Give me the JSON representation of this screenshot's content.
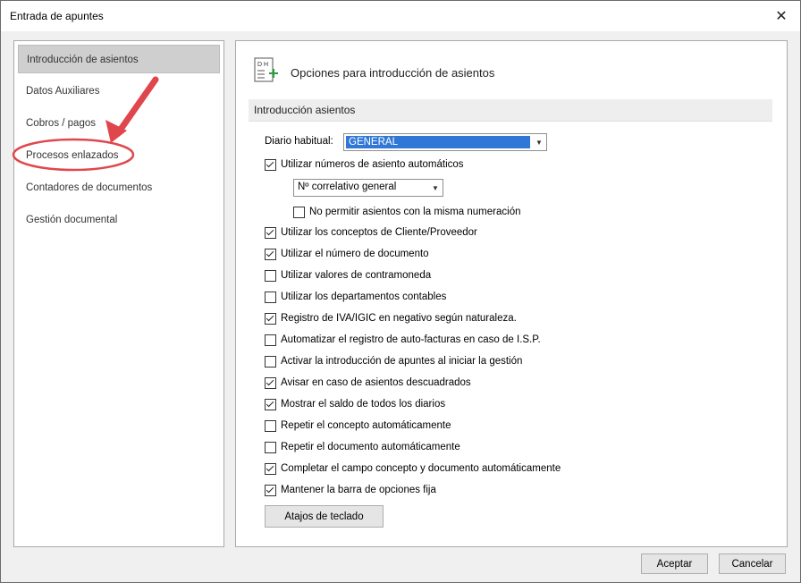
{
  "window": {
    "title": "Entrada de apuntes",
    "close_glyph": "✕"
  },
  "sidebar": {
    "items": [
      {
        "label": "Introducción de asientos",
        "active": true
      },
      {
        "label": "Datos Auxiliares"
      },
      {
        "label": "Cobros / pagos"
      },
      {
        "label": "Procesos enlazados"
      },
      {
        "label": "Contadores de documentos"
      },
      {
        "label": "Gestión documental"
      }
    ]
  },
  "main": {
    "header_icon": "journal-entry-icon",
    "header_icon_text": "D H",
    "title": "Opciones para introducción de asientos",
    "section": "Introducción asientos",
    "diario_label": "Diario habitual:",
    "diario_value": "GENERAL",
    "numbering_mode": "Nº correlativo general",
    "options": [
      {
        "label": "Utilizar números de asiento automáticos",
        "checked": true
      },
      {
        "label": "No permitir asientos con la misma numeración",
        "checked": false
      },
      {
        "label": "Utilizar los conceptos de Cliente/Proveedor",
        "checked": true
      },
      {
        "label": "Utilizar el número de documento",
        "checked": true
      },
      {
        "label": "Utilizar valores de contramoneda",
        "checked": false
      },
      {
        "label": "Utilizar los departamentos contables",
        "checked": false
      },
      {
        "label": "Registro de IVA/IGIC en negativo según naturaleza.",
        "checked": true
      },
      {
        "label": "Automatizar el registro de auto-facturas en caso de I.S.P.",
        "checked": false
      },
      {
        "label": "Activar la introducción de apuntes al iniciar la gestión",
        "checked": false
      },
      {
        "label": "Avisar en caso de asientos descuadrados",
        "checked": true
      },
      {
        "label": "Mostrar el saldo de todos los diarios",
        "checked": true
      },
      {
        "label": "Repetir el concepto automáticamente",
        "checked": false
      },
      {
        "label": "Repetir el documento automáticamente",
        "checked": false
      },
      {
        "label": "Completar el campo concepto y documento automáticamente",
        "checked": true
      },
      {
        "label": "Mantener la barra de opciones fija",
        "checked": true
      }
    ],
    "shortcuts_button": "Atajos de teclado"
  },
  "footer": {
    "accept": "Aceptar",
    "cancel": "Cancelar"
  },
  "colors": {
    "selection": "#3178d6",
    "annotation": "#e0474c",
    "active_item": "#cfcfcf"
  }
}
